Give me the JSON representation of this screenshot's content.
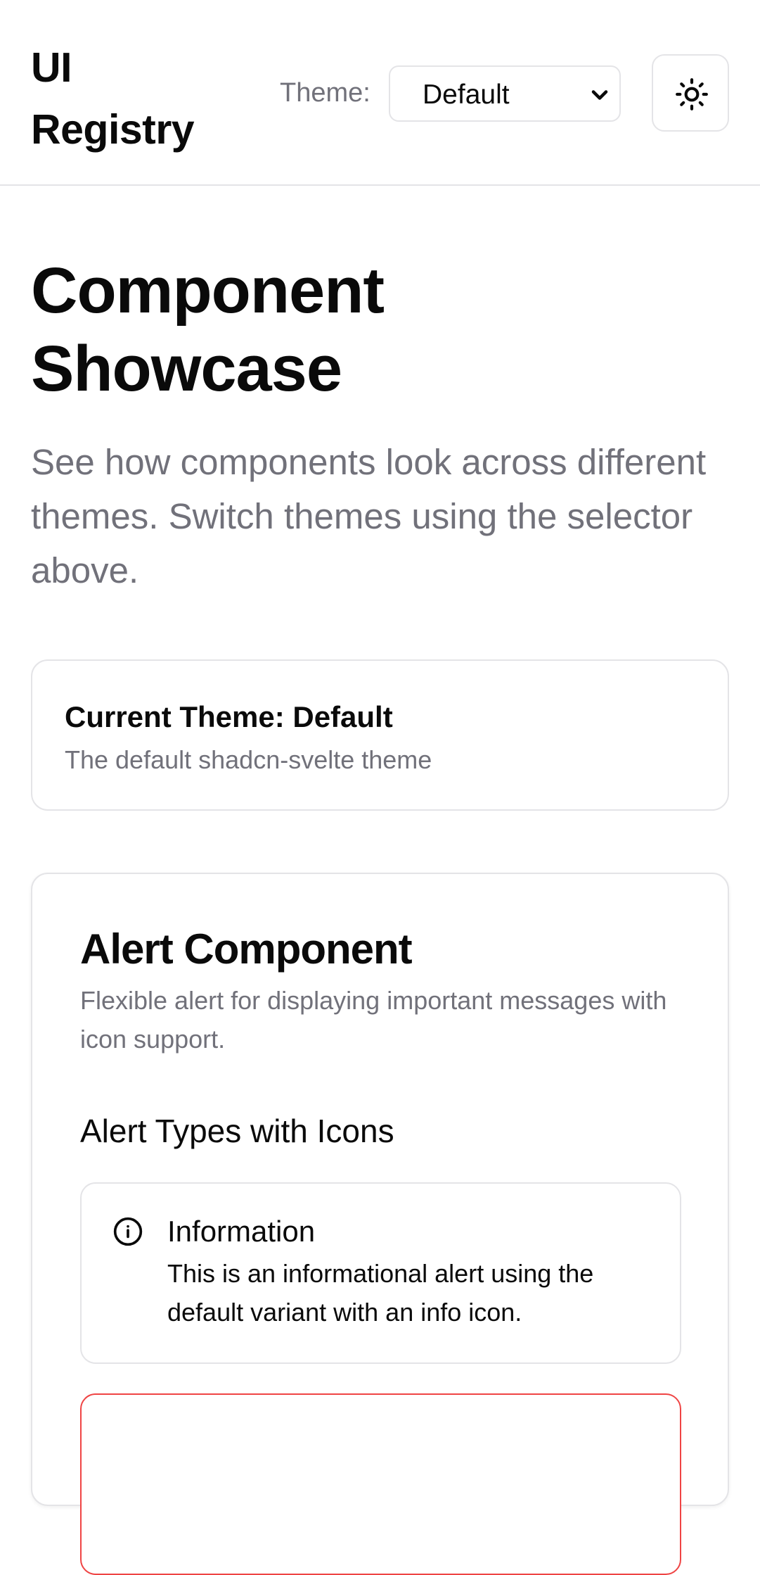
{
  "header": {
    "brand": "UI Registry",
    "theme_label": "Theme:",
    "theme_select": {
      "selected": "Default",
      "icon": "chevron-down-icon"
    },
    "theme_toggle": {
      "icon": "sun-icon"
    }
  },
  "page": {
    "title": "Component Showcase",
    "subtitle": "See how components look across different themes. Switch themes using the selector above."
  },
  "current_theme_card": {
    "title": "Current Theme: Default",
    "description": "The default shadcn-svelte theme"
  },
  "alert_section": {
    "title": "Alert Component",
    "description": "Flexible alert for displaying important messages with icon support.",
    "subsection_title": "Alert Types with Icons",
    "alerts": [
      {
        "variant": "default",
        "icon": "info-icon",
        "title": "Information",
        "description": "This is an informational alert using the default variant with an info icon."
      },
      {
        "variant": "destructive",
        "border_color": "#ef4444"
      }
    ]
  },
  "colors": {
    "foreground": "#0a0a0a",
    "muted": "#71717a",
    "border": "#e4e4e7",
    "destructive": "#ef4444"
  }
}
